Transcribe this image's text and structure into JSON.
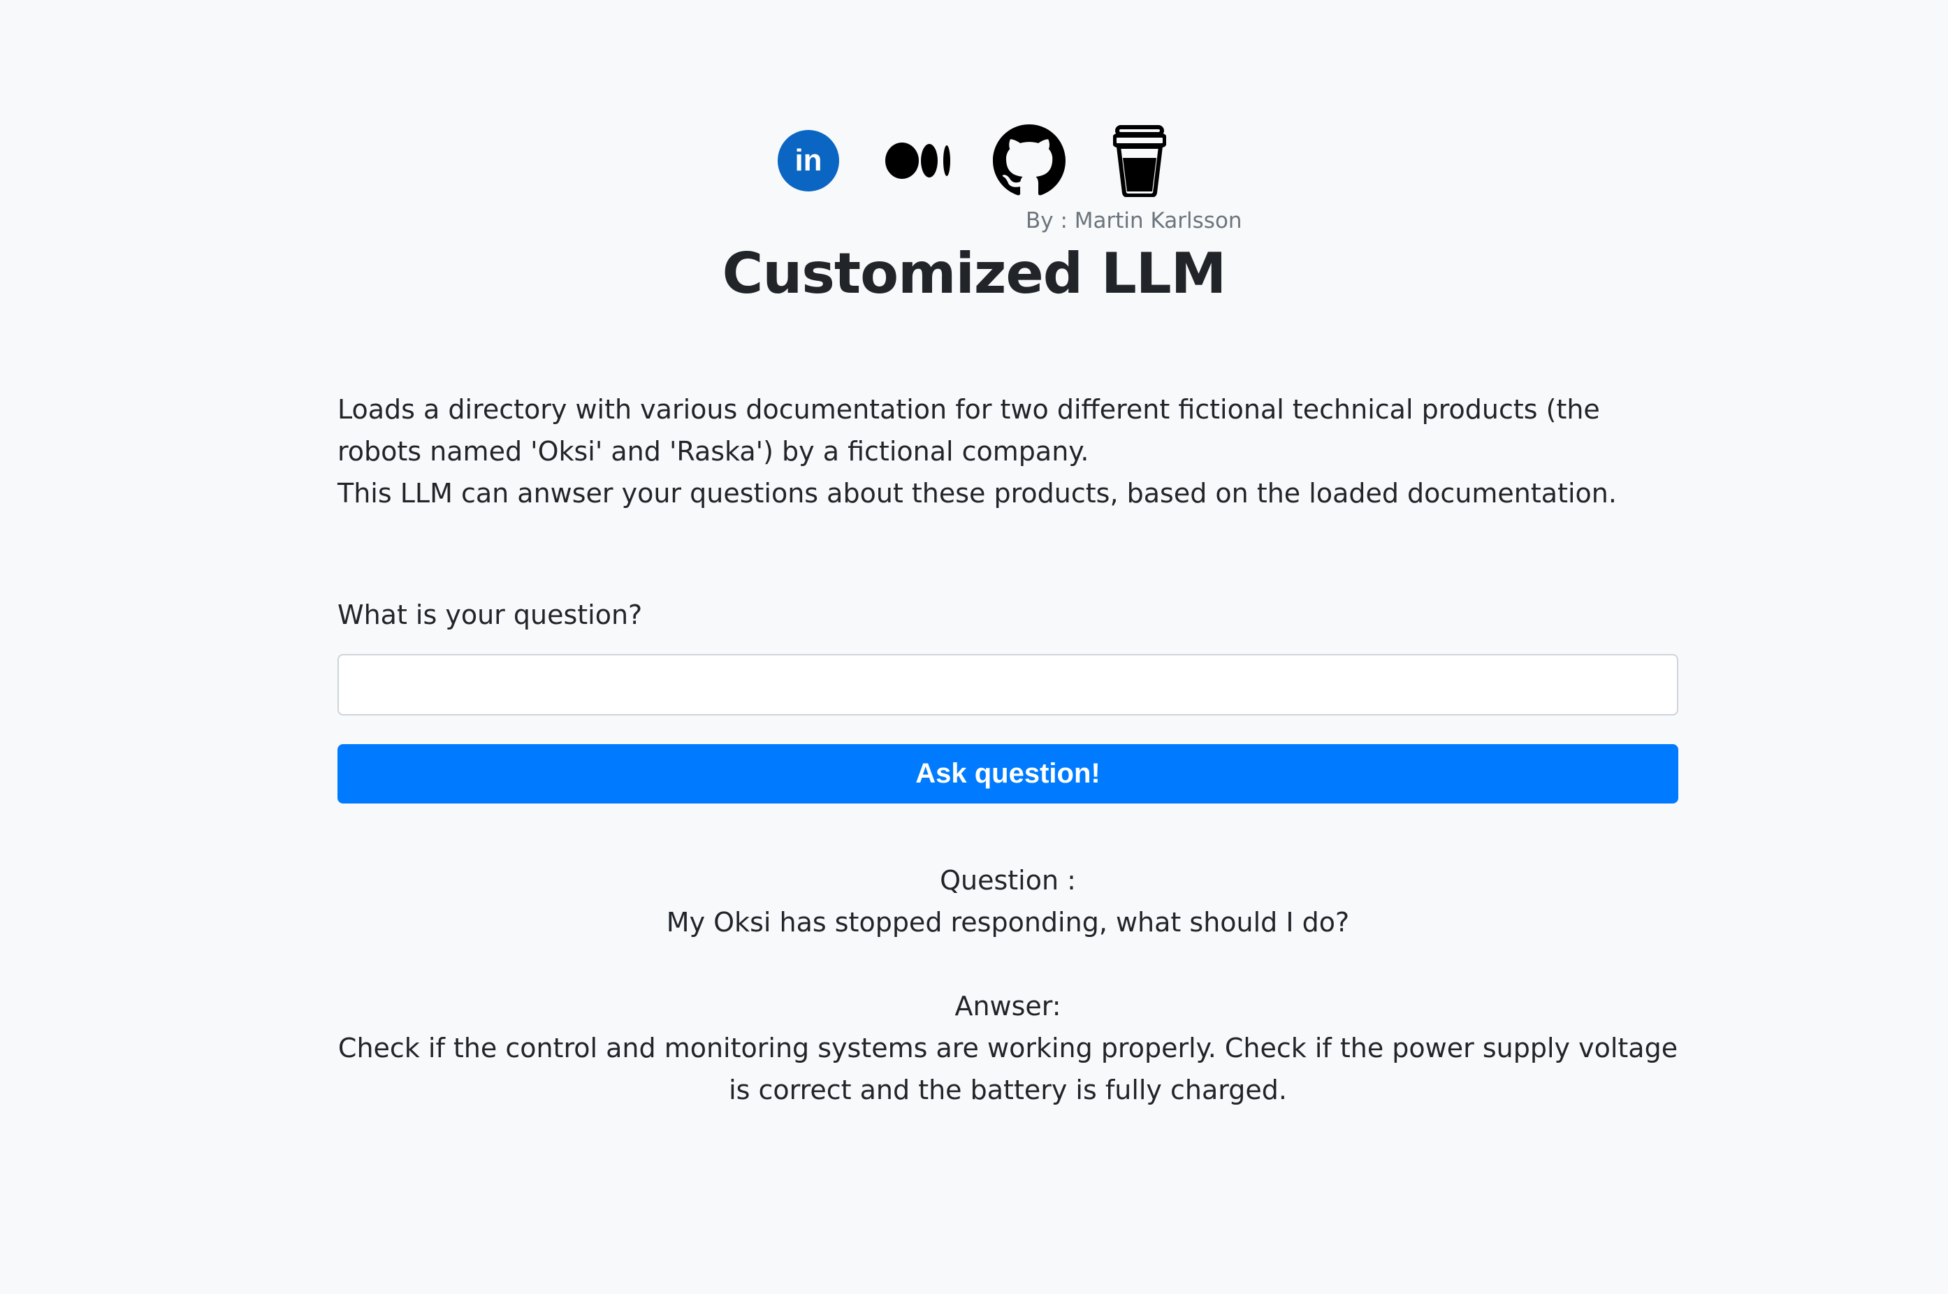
{
  "header": {
    "social_links": [
      {
        "icon": "linkedin-icon",
        "color": "#0a66c2"
      },
      {
        "icon": "medium-icon",
        "color": "#000000"
      },
      {
        "icon": "github-icon",
        "color": "#000000"
      },
      {
        "icon": "buy-me-a-coffee-icon",
        "color": "#000000"
      }
    ],
    "author": "By : Martin Karlsson",
    "title": "Customized LLM"
  },
  "description": {
    "line1": "Loads a directory with various documentation for two different fictional technical products (the robots named 'Oksi' and 'Raska') by a fictional company.",
    "line2": "This LLM can anwser your questions about these products, based on the loaded documentation."
  },
  "form": {
    "label": "What is your question?",
    "input_value": "",
    "input_placeholder": "",
    "button_label": "Ask question!"
  },
  "result": {
    "question_heading": "Question :",
    "question_text": "My Oksi has stopped responding, what should I do?",
    "answer_heading": "Anwser:",
    "answer_text": "Check if the control and monitoring systems are working properly. Check if the power supply voltage is correct and the battery is fully charged."
  },
  "colors": {
    "background": "#f8f9fa",
    "accent": "#007bff",
    "text": "#212529",
    "muted": "#6c757d"
  }
}
